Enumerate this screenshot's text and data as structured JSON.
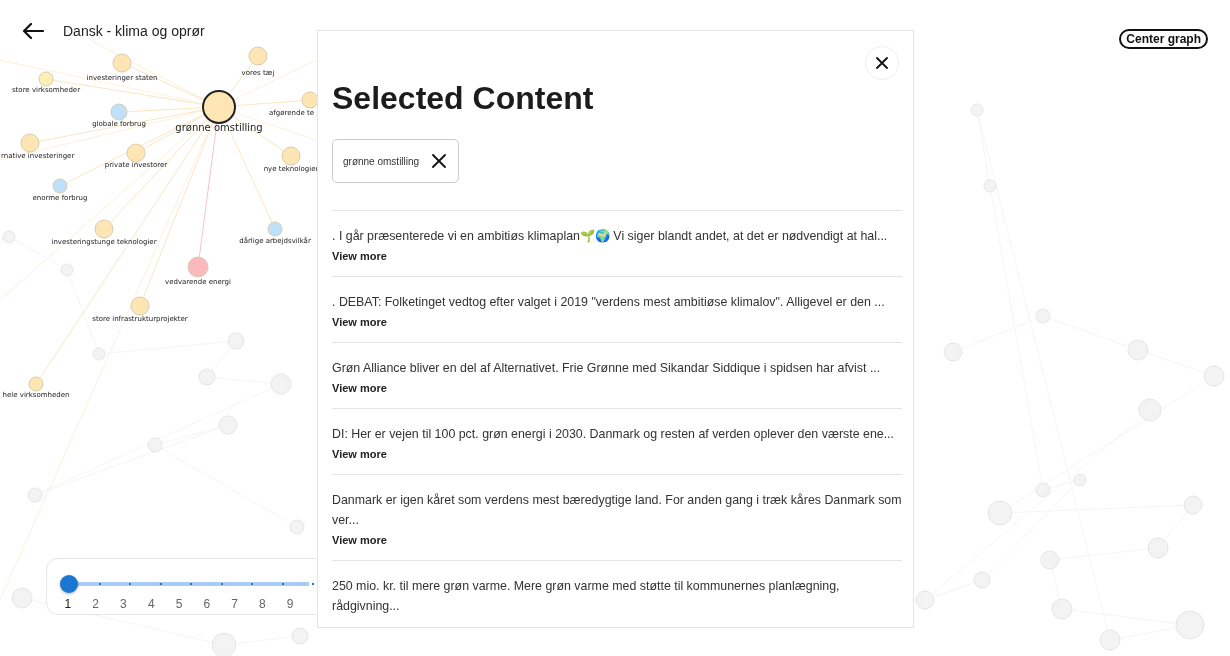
{
  "header": {
    "title": "Dansk - klima og oprør"
  },
  "toolbar": {
    "center_button": "Center graph"
  },
  "graph": {
    "nodes": [
      {
        "label": "investeringer staten",
        "color": "#fde6b4",
        "selected": false
      },
      {
        "label": "vores tæj",
        "color": "#fde6b4",
        "selected": false
      },
      {
        "label": "store virksomheder",
        "color": "#fdf0b4",
        "selected": false
      },
      {
        "label": "grønne omstilling",
        "color": "#fde6b4",
        "selected": true
      },
      {
        "label": "afgørende te",
        "color": "#fde6b4",
        "selected": false
      },
      {
        "label": "globale forbrug",
        "color": "#bfe0fa",
        "selected": false
      },
      {
        "label": "rnative investeringer",
        "color": "#fde6b4",
        "selected": false
      },
      {
        "label": "private investorer",
        "color": "#fde6b4",
        "selected": false
      },
      {
        "label": "nye teknologier",
        "color": "#fde6b4",
        "selected": false
      },
      {
        "label": "enorme forbrug",
        "color": "#bfe0fa",
        "selected": false
      },
      {
        "label": "investeringstunge teknologier",
        "color": "#fde6b4",
        "selected": false
      },
      {
        "label": "dårlige arbejdsvilkår",
        "color": "#bfe0fa",
        "selected": false
      },
      {
        "label": "vedvarende energi",
        "color": "#fbb8bd",
        "selected": false
      },
      {
        "label": "store infrastrukturprojekter",
        "color": "#fde6b4",
        "selected": false
      },
      {
        "label": "hele virksomheden",
        "color": "#fde6b4",
        "selected": false
      }
    ]
  },
  "timeline": {
    "ticks": [
      "1",
      "2",
      "3",
      "4",
      "5",
      "6",
      "7",
      "8",
      "9"
    ],
    "level": 0
  },
  "panel": {
    "title": "Selected Content",
    "filters": [
      {
        "label": "grønne omstilling"
      }
    ],
    "items": [
      {
        "text": ". I går præsenterede vi en ambitiøs klimaplan🌱🌍 Vi siger blandt andet, at det er nødvendigt at hal...",
        "link": "View more"
      },
      {
        "text": ". DEBAT: Folketinget vedtog efter valget i 2019 \"verdens mest ambitiøse klimalov\". Alligevel er den ...",
        "link": "View more"
      },
      {
        "text": "Grøn Alliance bliver en del af Alternativet. Frie Grønne med Sikandar Siddique i spidsen har afvist ...",
        "link": "View more"
      },
      {
        "text": "DI: Her er vejen til 100 pct. grøn energi i 2030. Danmark og resten af verden oplever den værste ene...",
        "link": "View more"
      },
      {
        "text": "Danmark er igen kåret som verdens mest bæredygtige land. For anden gang i træk kåres Danmark som ver...",
        "link": "View more"
      },
      {
        "text": "250 mio. kr. til mere grøn varme. Mere grøn varme med støtte til kommunernes planlægning, rådgivning..."
      }
    ]
  }
}
